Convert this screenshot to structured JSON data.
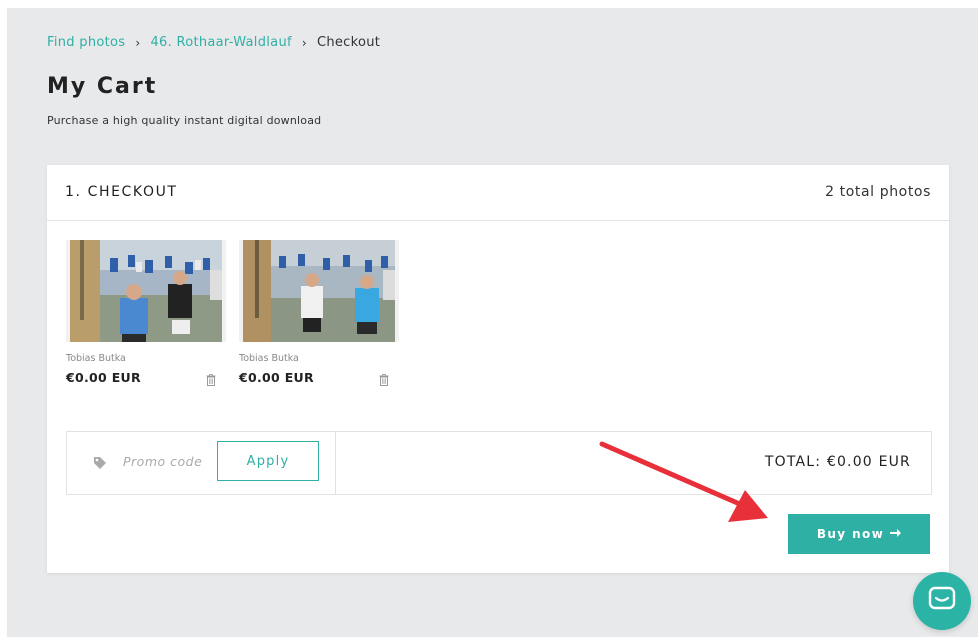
{
  "breadcrumb": {
    "items": [
      "Find photos",
      "46. Rothaar-Waldlauf"
    ],
    "current": "Checkout",
    "separator": "›"
  },
  "page": {
    "title": "My Cart",
    "subtitle": "Purchase a high quality instant digital download"
  },
  "checkout": {
    "title": "1. CHECKOUT",
    "count": "2 total photos",
    "items": [
      {
        "photographer": "Tobias Butka",
        "price": "€0.00 EUR"
      },
      {
        "photographer": "Tobias Butka",
        "price": "€0.00 EUR"
      }
    ],
    "promo": {
      "placeholder": "Promo code",
      "apply_label": "Apply"
    },
    "total": "TOTAL: €0.00 EUR",
    "buy_label": "Buy now"
  },
  "icons": {
    "breadcrumb_separator": "chevron-right-icon",
    "delete": "trash-icon",
    "promo": "tag-icon",
    "buy": "arrow-right-icon",
    "chat": "chat-icon"
  },
  "colors": {
    "accent": "#2fb0a4",
    "annotation_arrow": "#e8303a",
    "background": "#e8e9eb"
  }
}
